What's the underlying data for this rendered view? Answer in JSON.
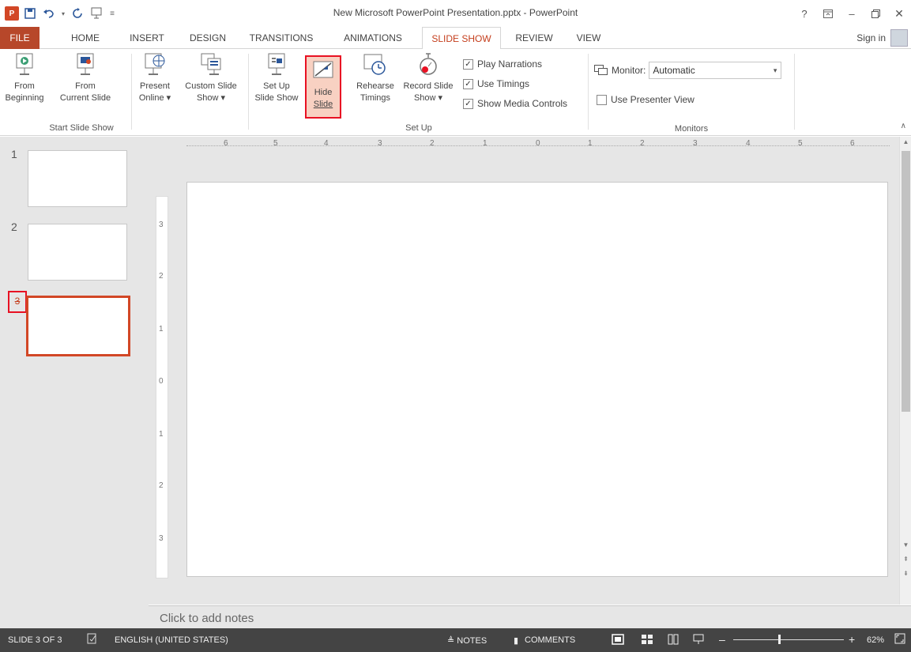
{
  "window": {
    "title": "New Microsoft PowerPoint Presentation.pptx - PowerPoint",
    "controls": [
      "?",
      "⧉",
      "–",
      "🗗",
      "✕"
    ]
  },
  "qat": {
    "logo": "P",
    "items": [
      "save-icon",
      "undo-icon",
      "redo-icon",
      "start-from-beginning-icon",
      "customize-qat-icon"
    ]
  },
  "tabs": [
    {
      "label": "FILE"
    },
    {
      "label": "HOME"
    },
    {
      "label": "INSERT"
    },
    {
      "label": "DESIGN"
    },
    {
      "label": "TRANSITIONS"
    },
    {
      "label": "ANIMATIONS"
    },
    {
      "label": "SLIDE SHOW"
    },
    {
      "label": "REVIEW"
    },
    {
      "label": "VIEW"
    }
  ],
  "active_tab": "SLIDE SHOW",
  "signin": "Sign in",
  "ribbon": {
    "start": {
      "label": "Start Slide Show",
      "from_beginning": [
        "From",
        "Beginning"
      ],
      "from_current": [
        "From",
        "Current Slide"
      ],
      "present_online": [
        "Present",
        "Online ▾"
      ],
      "custom_show": [
        "Custom Slide",
        "Show ▾"
      ]
    },
    "setup": {
      "label": "Set Up",
      "setup_show": [
        "Set Up",
        "Slide Show"
      ],
      "hide_slide": [
        "Hide",
        "Slide"
      ],
      "rehearse": [
        "Rehearse",
        "Timings"
      ],
      "record": [
        "Record Slide",
        "Show ▾"
      ],
      "play_narrations": "Play Narrations",
      "use_timings": "Use Timings",
      "show_media": "Show Media Controls"
    },
    "monitors": {
      "label": "Monitors",
      "monitor_label": "Monitor:",
      "monitor_value": "Automatic",
      "presenter_view": "Use Presenter View"
    }
  },
  "slides": [
    {
      "number": "1"
    },
    {
      "number": "2"
    },
    {
      "number": "3",
      "hidden_marker": "3"
    }
  ],
  "ruler": {
    "h_labels": [
      "6",
      "5",
      "4",
      "3",
      "2",
      "1",
      "0",
      "1",
      "2",
      "3",
      "4",
      "5",
      "6"
    ],
    "v_labels": [
      "3",
      "2",
      "1",
      "0",
      "1",
      "2",
      "3"
    ]
  },
  "notes_placeholder": "Click to add notes",
  "status": {
    "slide": "SLIDE 3 OF 3",
    "language": "ENGLISH (UNITED STATES)",
    "notes": "≜ NOTES",
    "comments": "COMMENTS",
    "zoom": "62%"
  }
}
